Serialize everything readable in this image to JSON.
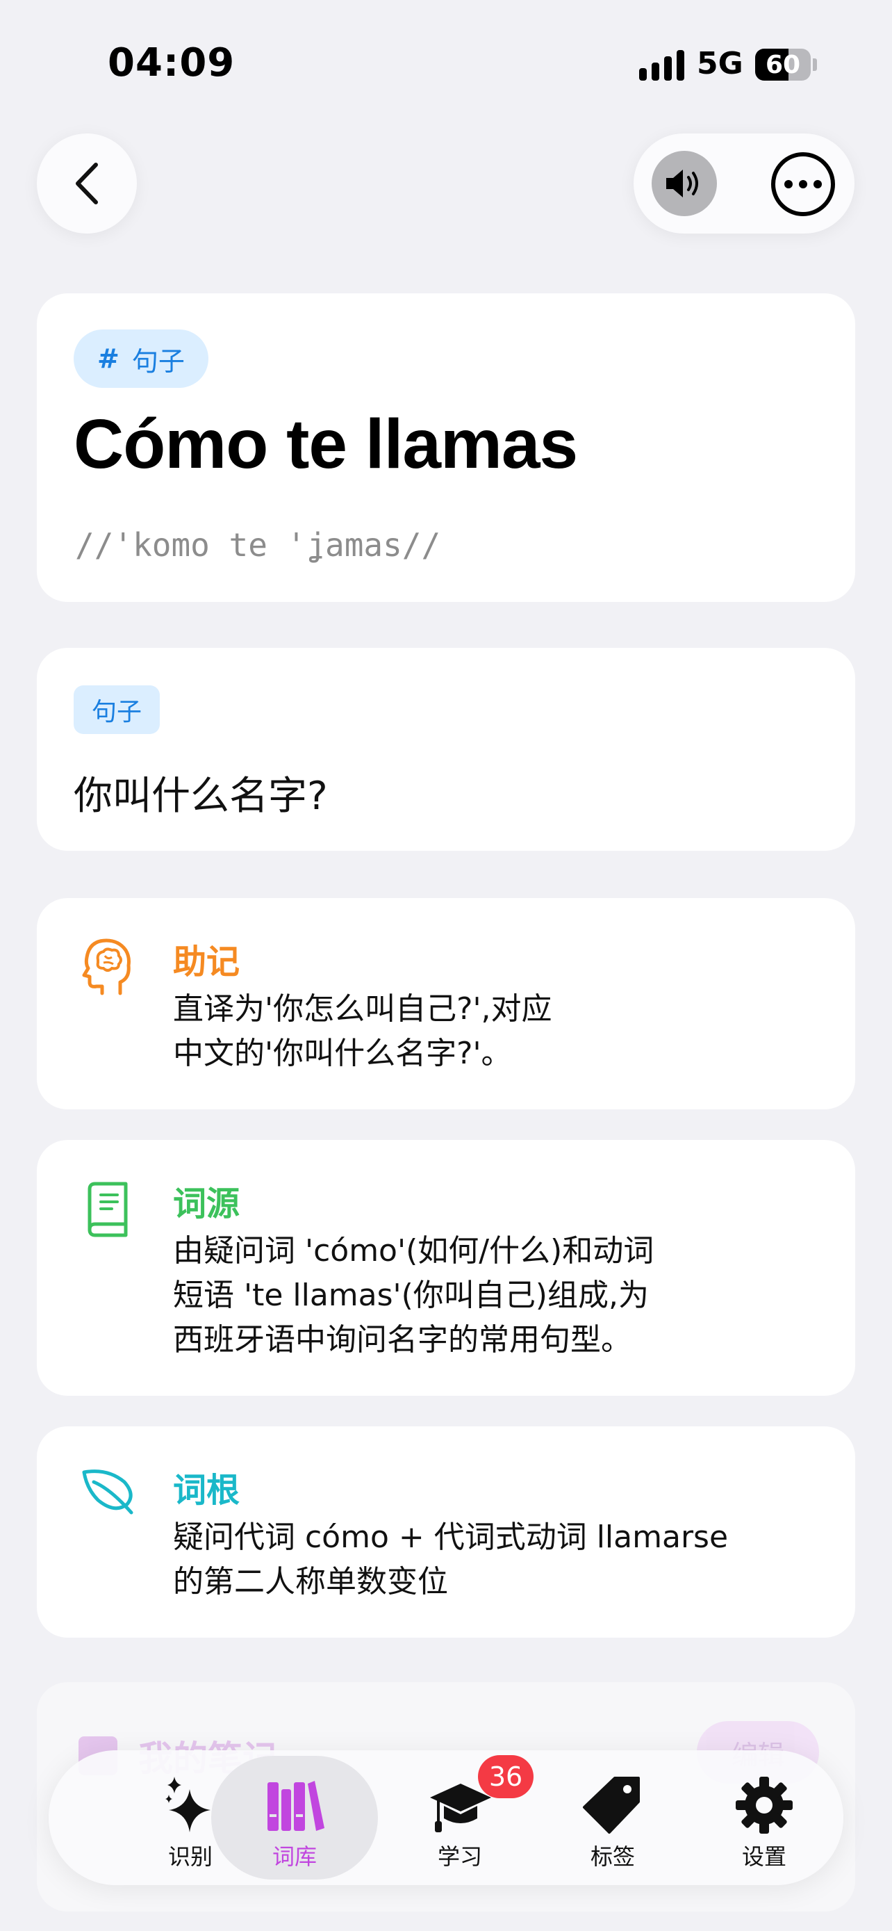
{
  "status_bar": {
    "time": "04:09",
    "network": "5G",
    "battery": "60",
    "battery_level": 0.6
  },
  "header": {
    "tag": "句子",
    "title": "Cómo te llamas",
    "phonetic": "//'komo te 'ʝamas//"
  },
  "meaning_card": {
    "type": "句子",
    "text": "你叫什么名字?"
  },
  "sections": [
    {
      "title": "助记",
      "color": "#f58a22",
      "icon": "brain-head-icon",
      "lines": [
        "直译为'你怎么叫自己?',对应",
        "中文的'你叫什么名字?'。"
      ]
    },
    {
      "title": "词源",
      "color": "#3cc15b",
      "icon": "book-icon",
      "lines": [
        "由疑问词 'cómo'(如何/什么)和动词",
        "短语 'te llamas'(你叫自己)组成,为",
        "西班牙语中询问名字的常用句型。"
      ]
    },
    {
      "title": "词根",
      "color": "#1ab8c9",
      "icon": "leaf-icon",
      "lines": [
        "疑问代词 cómo + 代词式动词 llamarse",
        "的第二人称单数变位"
      ]
    }
  ],
  "notes": {
    "title": "我的笔记",
    "button": "编辑"
  },
  "tab_bar": {
    "tabs": [
      {
        "label": "识别",
        "icon": "sparkles-icon"
      },
      {
        "label": "词库",
        "icon": "library-icon"
      },
      {
        "label": "学习",
        "icon": "graduation-cap-icon"
      },
      {
        "label": "标签",
        "icon": "tag-icon"
      },
      {
        "label": "设置",
        "icon": "gear-icon"
      }
    ],
    "active_index": 1,
    "badge": "36"
  },
  "colors": {
    "accent": "#c146df",
    "tag_blue": "#1a7fe0",
    "badge_red": "#f43a44"
  }
}
